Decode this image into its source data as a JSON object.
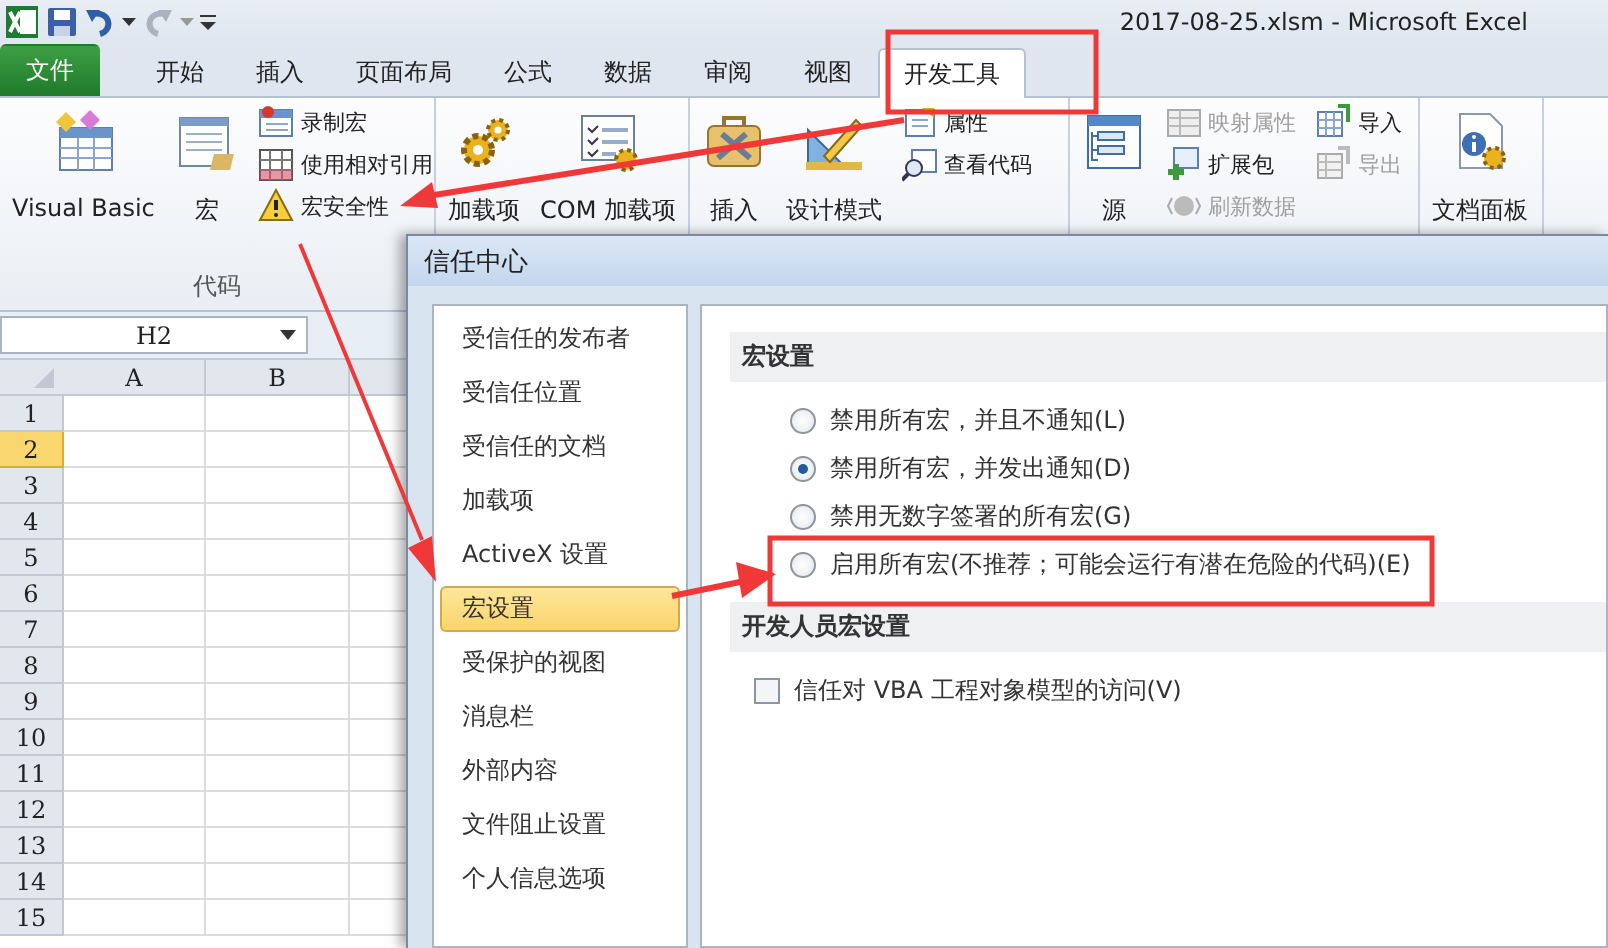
{
  "window": {
    "title": "2017-08-25.xlsm  -  Microsoft Excel"
  },
  "ribbon_tabs": [
    {
      "label": "文件",
      "kind": "file",
      "selected": false
    },
    {
      "label": "开始",
      "kind": "tab",
      "selected": false
    },
    {
      "label": "插入",
      "kind": "tab",
      "selected": false
    },
    {
      "label": "页面布局",
      "kind": "tab",
      "selected": false
    },
    {
      "label": "公式",
      "kind": "tab",
      "selected": false
    },
    {
      "label": "数据",
      "kind": "tab",
      "selected": false
    },
    {
      "label": "审阅",
      "kind": "tab",
      "selected": false
    },
    {
      "label": "视图",
      "kind": "tab",
      "selected": false
    },
    {
      "label": "开发工具",
      "kind": "tab",
      "selected": true
    }
  ],
  "ribbon_groups": [
    {
      "label": "代码",
      "items": [
        {
          "kind": "large",
          "label": "Visual Basic",
          "disabled": false
        },
        {
          "kind": "large",
          "label": "宏",
          "disabled": false
        },
        {
          "kind": "stack",
          "items": [
            {
              "label": "录制宏",
              "disabled": false
            },
            {
              "label": "使用相对引用",
              "disabled": false
            },
            {
              "label": "宏安全性",
              "disabled": false
            }
          ]
        }
      ]
    },
    {
      "items": [
        {
          "kind": "large",
          "label": "加载项",
          "disabled": false
        },
        {
          "kind": "large",
          "label": "COM 加载项",
          "disabled": false
        }
      ]
    },
    {
      "items": [
        {
          "kind": "large",
          "label": "插入",
          "disabled": false
        },
        {
          "kind": "large",
          "label": "设计模式",
          "disabled": false
        },
        {
          "kind": "stack",
          "items": [
            {
              "label": "属性",
              "disabled": false
            },
            {
              "label": "查看代码",
              "disabled": false
            }
          ]
        }
      ]
    },
    {
      "items": [
        {
          "kind": "large",
          "label": "源",
          "disabled": false
        },
        {
          "kind": "stack",
          "items": [
            {
              "label": "映射属性",
              "disabled": true
            },
            {
              "label": "扩展包",
              "disabled": false
            },
            {
              "label": "刷新数据",
              "disabled": true
            }
          ]
        },
        {
          "kind": "stack",
          "items": [
            {
              "label": "导入",
              "disabled": false
            },
            {
              "label": "导出",
              "disabled": true
            }
          ]
        }
      ]
    },
    {
      "items": [
        {
          "kind": "large",
          "label": "文档面板",
          "disabled": false
        }
      ]
    }
  ],
  "name_box": {
    "value": "H2"
  },
  "sheet": {
    "columns": [
      "A",
      "B"
    ],
    "rows": [
      {
        "label": "1",
        "selected": false
      },
      {
        "label": "2",
        "selected": true
      },
      {
        "label": "3",
        "selected": false
      },
      {
        "label": "4",
        "selected": false
      },
      {
        "label": "5",
        "selected": false
      },
      {
        "label": "6",
        "selected": false
      },
      {
        "label": "7",
        "selected": false
      },
      {
        "label": "8",
        "selected": false
      },
      {
        "label": "9",
        "selected": false
      },
      {
        "label": "10",
        "selected": false
      },
      {
        "label": "11",
        "selected": false
      },
      {
        "label": "12",
        "selected": false
      },
      {
        "label": "13",
        "selected": false
      },
      {
        "label": "14",
        "selected": false
      },
      {
        "label": "15",
        "selected": false
      }
    ]
  },
  "dialog": {
    "title": "信任中心",
    "nav": [
      {
        "label": "受信任的发布者",
        "selected": false
      },
      {
        "label": "受信任位置",
        "selected": false
      },
      {
        "label": "受信任的文档",
        "selected": false
      },
      {
        "label": "加载项",
        "selected": false
      },
      {
        "label": "ActiveX 设置",
        "selected": false
      },
      {
        "label": "宏设置",
        "selected": true
      },
      {
        "label": "受保护的视图",
        "selected": false
      },
      {
        "label": "消息栏",
        "selected": false
      },
      {
        "label": "外部内容",
        "selected": false
      },
      {
        "label": "文件阻止设置",
        "selected": false
      },
      {
        "label": "个人信息选项",
        "selected": false
      }
    ],
    "sections": [
      {
        "title": "宏设置",
        "options": [
          {
            "kind": "radio",
            "label": "禁用所有宏，并且不通知(L)",
            "selected": false
          },
          {
            "kind": "radio",
            "label": "禁用所有宏，并发出通知(D)",
            "selected": true
          },
          {
            "kind": "radio",
            "label": "禁用无数字签署的所有宏(G)",
            "selected": false
          },
          {
            "kind": "radio",
            "label": "启用所有宏(不推荐；可能会运行有潜在危险的代码)(E)",
            "selected": false
          }
        ]
      },
      {
        "title": "开发人员宏设置",
        "options": [
          {
            "kind": "checkbox",
            "label": "信任对 VBA 工程对象模型的访问(V)",
            "checked": false
          }
        ]
      }
    ]
  }
}
